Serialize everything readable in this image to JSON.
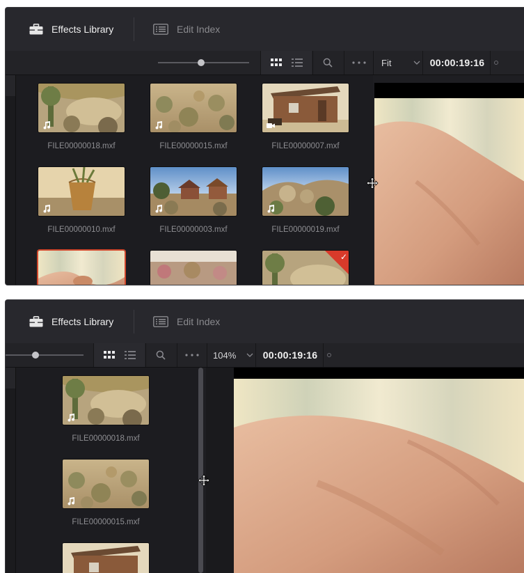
{
  "panels": [
    {
      "tabs": {
        "effects_label": "Effects Library",
        "edit_label": "Edit Index"
      },
      "toolbar": {
        "zoom": "Fit",
        "timecode": "00:00:19:16"
      },
      "clips": [
        {
          "name": "FILE00000018.mxf",
          "thumb": "desert-yucca",
          "badge": "music-note-icon"
        },
        {
          "name": "FILE00000015.mxf",
          "thumb": "desert-shrubs",
          "badge": "music-note-icon"
        },
        {
          "name": "FILE00000007.mxf",
          "thumb": "wooden-shack",
          "badge": "video-icon"
        },
        {
          "name": "FILE00000010.mxf",
          "thumb": "wooden-bucket",
          "badge": "music-note-icon"
        },
        {
          "name": "FILE00000003.mxf",
          "thumb": "ranch-buildings",
          "badge": "music-note-icon"
        },
        {
          "name": "FILE00000019.mxf",
          "thumb": "rocky-hills",
          "badge": "music-note-icon"
        },
        {
          "thumb": "hands",
          "selected": true
        },
        {
          "thumb": "desert-pink"
        },
        {
          "thumb": "desert-yucca",
          "flagged": true
        }
      ]
    },
    {
      "tabs": {
        "effects_label": "Effects Library",
        "edit_label": "Edit Index"
      },
      "toolbar": {
        "zoom": "104%",
        "timecode": "00:00:19:16"
      },
      "clips": [
        {
          "name": "FILE00000018.mxf",
          "thumb": "desert-yucca",
          "badge": "music-note-icon"
        },
        {
          "name": "FILE00000015.mxf",
          "thumb": "desert-shrubs",
          "badge": "music-note-icon"
        },
        {
          "thumb": "wooden-shack"
        }
      ]
    }
  ],
  "colors": {
    "selection": "#d2482c",
    "flag": "#d83a2a",
    "panel_bg": "#1e1e22",
    "toolbar_bg": "#232327"
  }
}
